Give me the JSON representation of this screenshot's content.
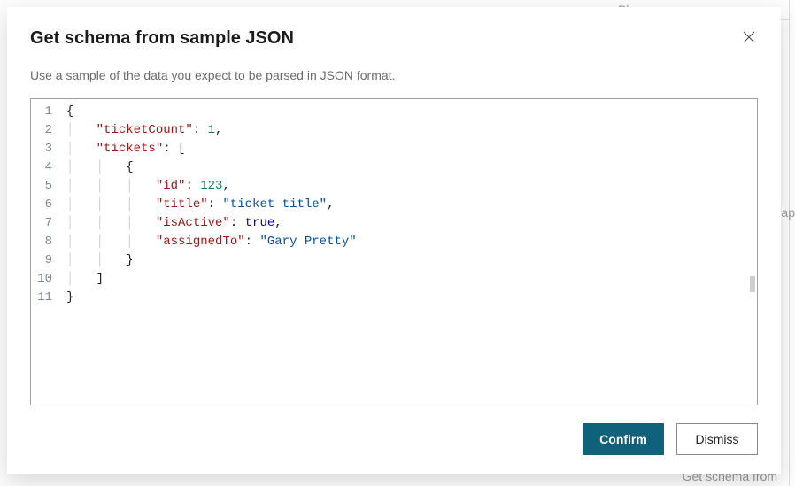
{
  "background": {
    "phrases_label": "Phrases",
    "get_schema_label": "Get schema from",
    "ap_fragment": "ap"
  },
  "dialog": {
    "title": "Get schema from sample JSON",
    "subtitle": "Use a sample of the data you expect to be parsed in JSON format.",
    "editor": {
      "line_numbers": [
        "1",
        "2",
        "3",
        "4",
        "5",
        "6",
        "7",
        "8",
        "9",
        "10",
        "11"
      ],
      "lines": [
        {
          "indent": 0,
          "tokens": [
            {
              "t": "brace",
              "v": "{"
            }
          ]
        },
        {
          "indent": 1,
          "tokens": [
            {
              "t": "key",
              "v": "\"ticketCount\""
            },
            {
              "t": "plain",
              "v": ": "
            },
            {
              "t": "num",
              "v": "1"
            },
            {
              "t": "plain",
              "v": ","
            }
          ]
        },
        {
          "indent": 1,
          "tokens": [
            {
              "t": "key",
              "v": "\"tickets\""
            },
            {
              "t": "plain",
              "v": ": ["
            }
          ]
        },
        {
          "indent": 2,
          "tokens": [
            {
              "t": "brace",
              "v": "{"
            }
          ]
        },
        {
          "indent": 3,
          "tokens": [
            {
              "t": "key",
              "v": "\"id\""
            },
            {
              "t": "plain",
              "v": ": "
            },
            {
              "t": "num",
              "v": "123"
            },
            {
              "t": "plain",
              "v": ","
            }
          ]
        },
        {
          "indent": 3,
          "tokens": [
            {
              "t": "key",
              "v": "\"title\""
            },
            {
              "t": "plain",
              "v": ": "
            },
            {
              "t": "str",
              "v": "\"ticket title\""
            },
            {
              "t": "plain",
              "v": ","
            }
          ]
        },
        {
          "indent": 3,
          "tokens": [
            {
              "t": "key",
              "v": "\"isActive\""
            },
            {
              "t": "plain",
              "v": ": "
            },
            {
              "t": "bool",
              "v": "true"
            },
            {
              "t": "plain",
              "v": ","
            }
          ]
        },
        {
          "indent": 3,
          "tokens": [
            {
              "t": "key",
              "v": "\"assignedTo\""
            },
            {
              "t": "plain",
              "v": ": "
            },
            {
              "t": "str",
              "v": "\"Gary Pretty\""
            }
          ]
        },
        {
          "indent": 2,
          "tokens": [
            {
              "t": "brace",
              "v": "}"
            }
          ]
        },
        {
          "indent": 1,
          "tokens": [
            {
              "t": "plain",
              "v": "]"
            }
          ]
        },
        {
          "indent": 0,
          "tokens": [
            {
              "t": "brace",
              "v": "}"
            }
          ]
        }
      ]
    },
    "buttons": {
      "confirm": "Confirm",
      "dismiss": "Dismiss"
    }
  }
}
